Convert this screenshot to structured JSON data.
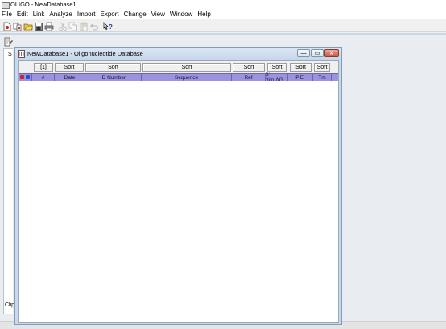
{
  "app": {
    "title": "OLIGO - NewDatabase1"
  },
  "menu": [
    "File",
    "Edit",
    "Link",
    "Analyze",
    "Import",
    "Export",
    "Change",
    "View",
    "Window",
    "Help"
  ],
  "toolbar_icons": [
    "new-document-icon",
    "copy-document-icon",
    "open-folder-icon",
    "save-icon",
    "print-icon",
    "cut-icon",
    "copy-icon",
    "paste-icon",
    "undo-icon",
    "help-pointer-icon"
  ],
  "background_window": {
    "fragment_top": "S",
    "fragment_bottom": "Clip"
  },
  "db_window": {
    "title": "NewDatabase1 - Oligonucleotide Database",
    "buttons": {
      "minimize": "—",
      "maximize": "▭",
      "close": "✕"
    }
  },
  "sort_row": [
    "[1]",
    "Sort",
    "Sort",
    "Sort",
    "Sort",
    "Sort",
    "Sort",
    "Sort"
  ],
  "columns": [
    "#",
    "Date",
    "ID Number",
    "Sequence",
    "Ref",
    "3' dim.ΔG",
    "P.E.",
    "Tm"
  ],
  "colors": {
    "header_bg": "#9a93dd",
    "flag_red": "#d0202a",
    "flag_blue": "#2a4ad8"
  }
}
